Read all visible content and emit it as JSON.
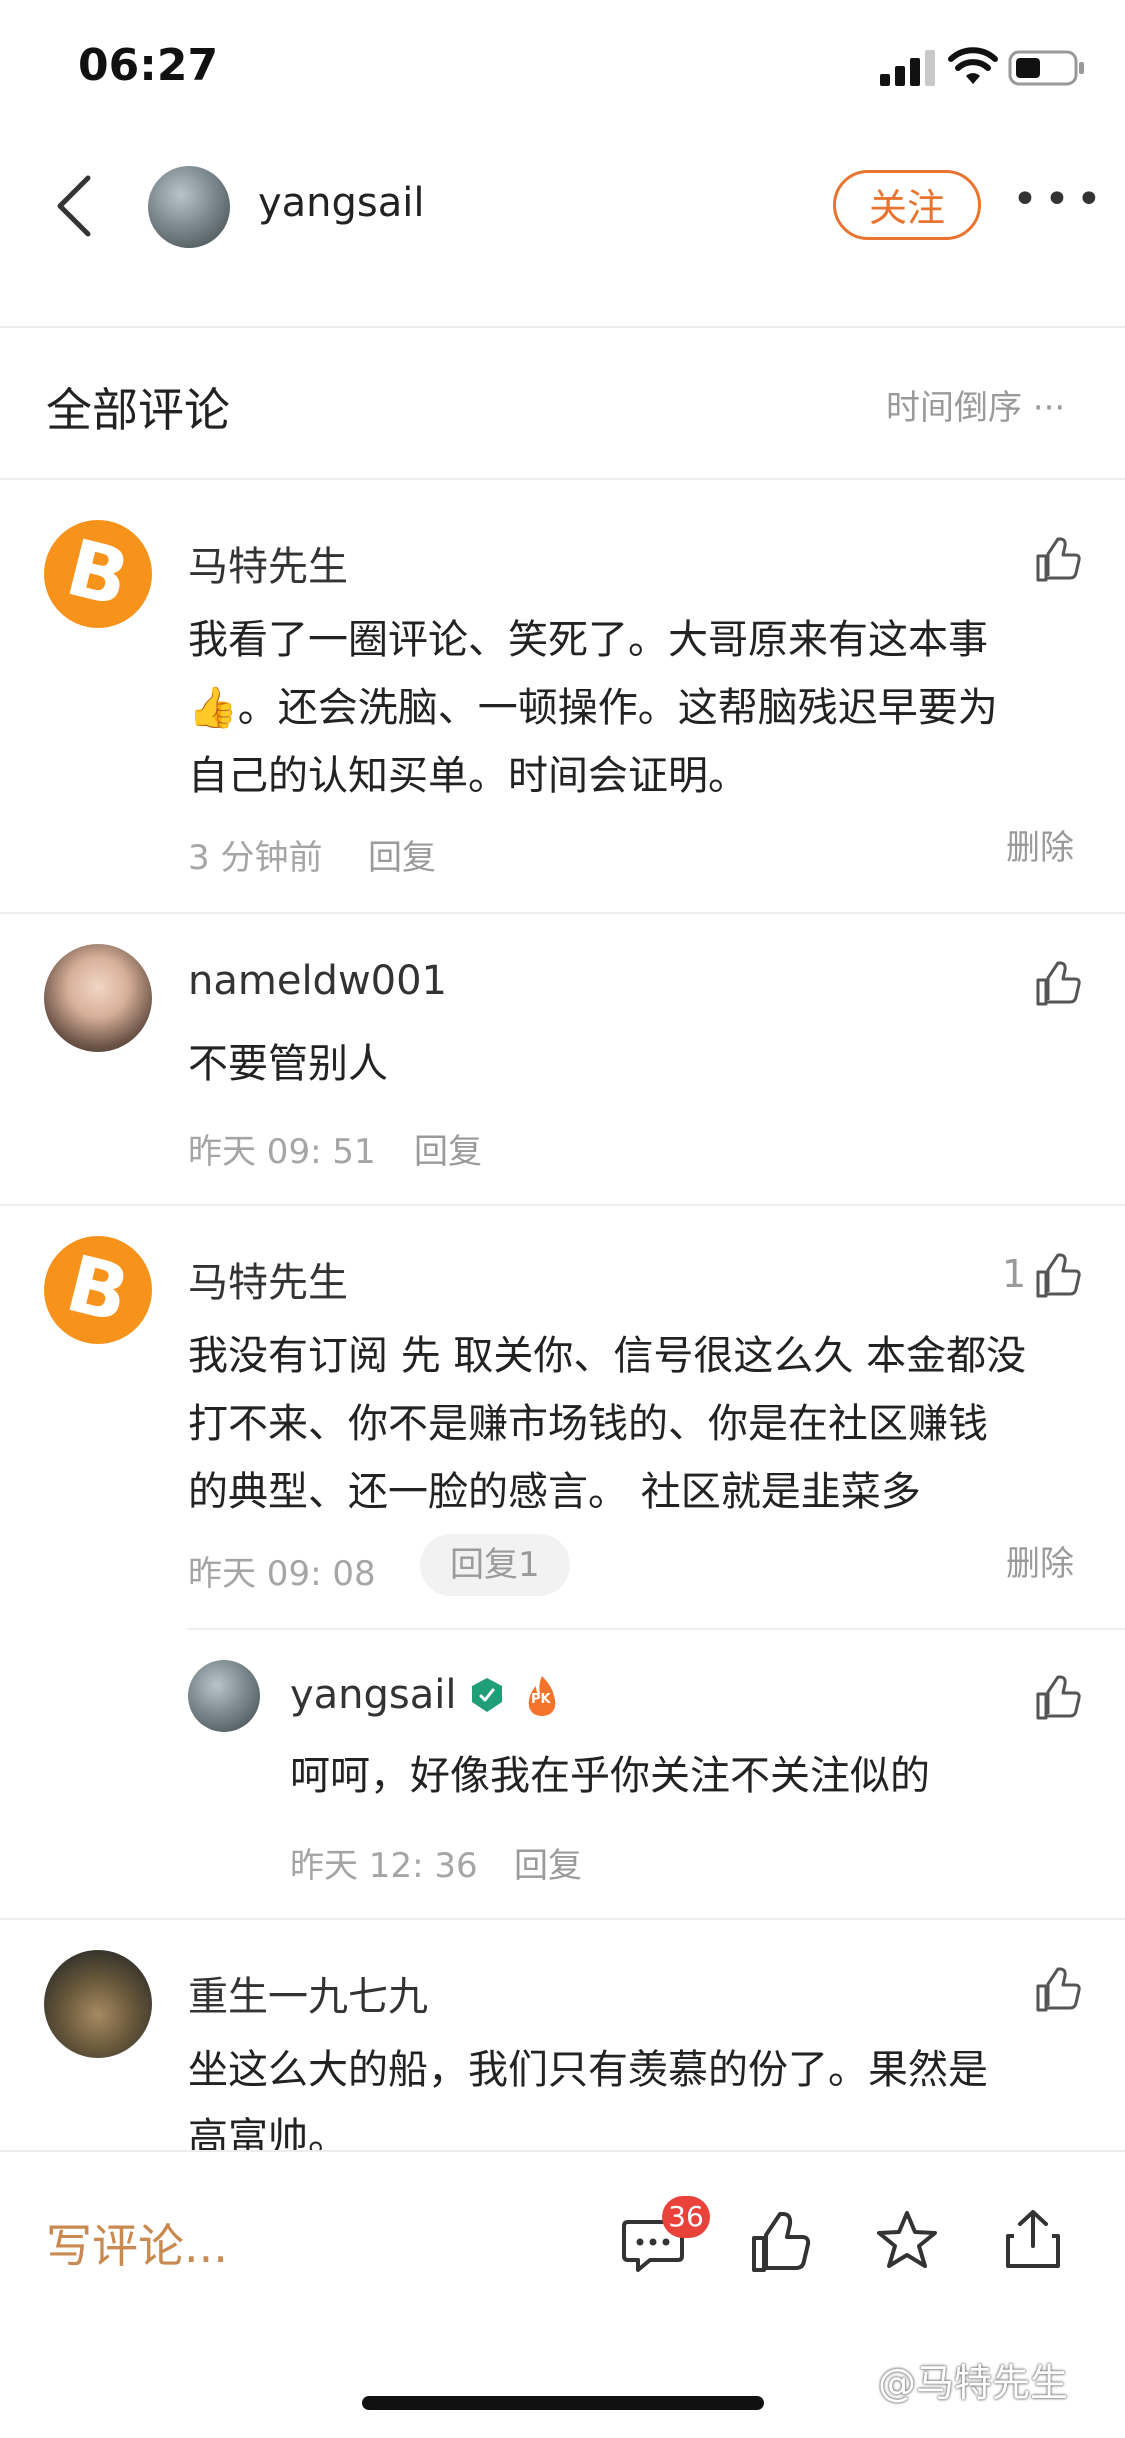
{
  "status_bar": {
    "time": "06:27"
  },
  "header": {
    "username": "yangsail",
    "follow_label": "关注"
  },
  "section": {
    "title": "全部评论",
    "sort_label": "时间倒序"
  },
  "comments": [
    {
      "name": "马特先生",
      "text_lines": [
        "我看了一圈评论、笑死了。大哥原来有这本事",
        "👍。还会洗脑、一顿操作。这帮脑残迟早要为",
        "自己的认知买单。时间会证明。"
      ],
      "time": "3 分钟前",
      "reply": "回复",
      "delete": "删除"
    },
    {
      "name": "nameldw001",
      "text_lines": [
        "不要管别人"
      ],
      "time": "昨天 09: 51",
      "reply": "回复"
    },
    {
      "name": "马特先生",
      "text_lines": [
        "我没有订阅 先 取关你、信号很这么久 本金都没",
        "打不来、你不是赚市场钱的、你是在社区赚钱",
        "的典型、还一脸的感言。 社区就是韭菜多"
      ],
      "time": "昨天 09: 08",
      "reply": "回复1",
      "delete": "删除",
      "likes": "1"
    },
    {
      "name": "重生一九七九",
      "text_lines": [
        "坐这么大的船，我们只有羡慕的份了。果然是",
        "高富帅。"
      ]
    }
  ],
  "nested_reply": {
    "name": "yangsail",
    "badge_pk": "PK",
    "text": "呵呵，好像我在乎你关注不关注似的",
    "time": "昨天 12: 36",
    "reply": "回复"
  },
  "bottom_bar": {
    "write_placeholder": "写评论...",
    "comment_count": "36"
  },
  "watermark": "@马特先生",
  "avatar_glyph": "B",
  "colors": {
    "accent": "#e8742f",
    "badge_red": "#e8423a",
    "bitcoin": "#f7931a"
  }
}
